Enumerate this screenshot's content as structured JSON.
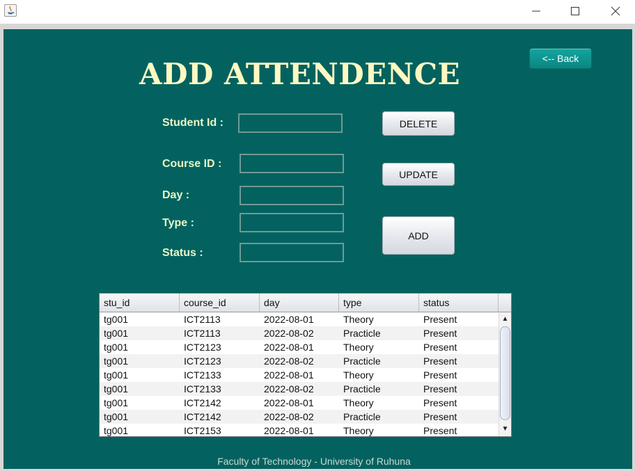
{
  "window": {
    "title": "",
    "controls": {
      "minimize": "minimize-icon",
      "maximize": "maximize-icon",
      "close": "close-icon"
    }
  },
  "colors": {
    "panel": "#03625f",
    "title": "#fff8c2",
    "label": "#e9f7c7",
    "back_button": "#0f918d"
  },
  "header": {
    "title": "ADD ATTENDENCE",
    "back_label": "<-- Back"
  },
  "form": {
    "student_id_label": "Student Id :",
    "course_id_label": "Course ID :",
    "day_label": "Day :",
    "type_label": "Type :",
    "status_label": "Status :",
    "student_id_value": "",
    "course_id_value": "",
    "day_value": "",
    "type_value": "",
    "status_value": ""
  },
  "actions": {
    "delete_label": "DELETE",
    "update_label": "UPDATE",
    "add_label": "ADD"
  },
  "table": {
    "columns": [
      "stu_id",
      "course_id",
      "day",
      "type",
      "status"
    ],
    "rows": [
      [
        "tg001",
        "ICT2113",
        "2022-08-01",
        "Theory",
        "Present"
      ],
      [
        "tg001",
        "ICT2113",
        "2022-08-02",
        "Practicle",
        "Present"
      ],
      [
        "tg001",
        "ICT2123",
        "2022-08-01",
        "Theory",
        "Present"
      ],
      [
        "tg001",
        "ICT2123",
        "2022-08-02",
        "Practicle",
        "Present"
      ],
      [
        "tg001",
        "ICT2133",
        "2022-08-01",
        "Theory",
        "Present"
      ],
      [
        "tg001",
        "ICT2133",
        "2022-08-02",
        "Practicle",
        "Present"
      ],
      [
        "tg001",
        "ICT2142",
        "2022-08-01",
        "Theory",
        "Present"
      ],
      [
        "tg001",
        "ICT2142",
        "2022-08-02",
        "Practicle",
        "Present"
      ],
      [
        "tg001",
        "ICT2153",
        "2022-08-01",
        "Theory",
        "Present"
      ]
    ]
  },
  "footer": {
    "text": "Faculty of Technology - University of Ruhuna"
  }
}
